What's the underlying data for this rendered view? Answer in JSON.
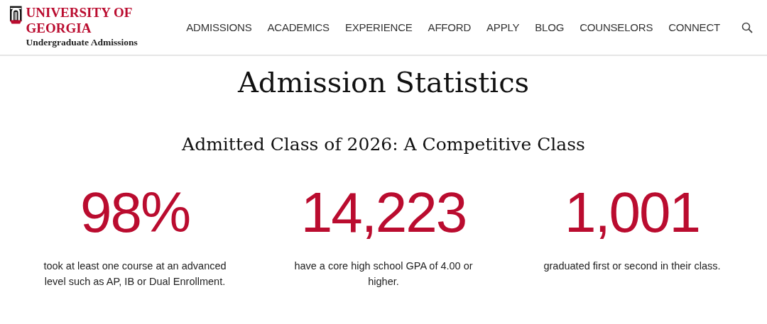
{
  "header": {
    "logo_title": "UNIVERSITY OF GEORGIA",
    "logo_subtitle": "Undergraduate Admissions"
  },
  "nav": [
    "ADMISSIONS",
    "ACADEMICS",
    "EXPERIENCE",
    "AFFORD",
    "APPLY",
    "BLOG",
    "COUNSELORS",
    "CONNECT"
  ],
  "title": "Admission Statistics",
  "subtitle": "Admitted Class of 2026: A Competitive Class",
  "stats": [
    {
      "value": "98%",
      "caption": "took at least one course at an advanced level such as AP, IB or Dual Enrollment."
    },
    {
      "value": "14,223",
      "caption": "have a core high school GPA of 4.00 or higher."
    },
    {
      "value": "1,001",
      "caption": "graduated first or second in their class."
    }
  ]
}
